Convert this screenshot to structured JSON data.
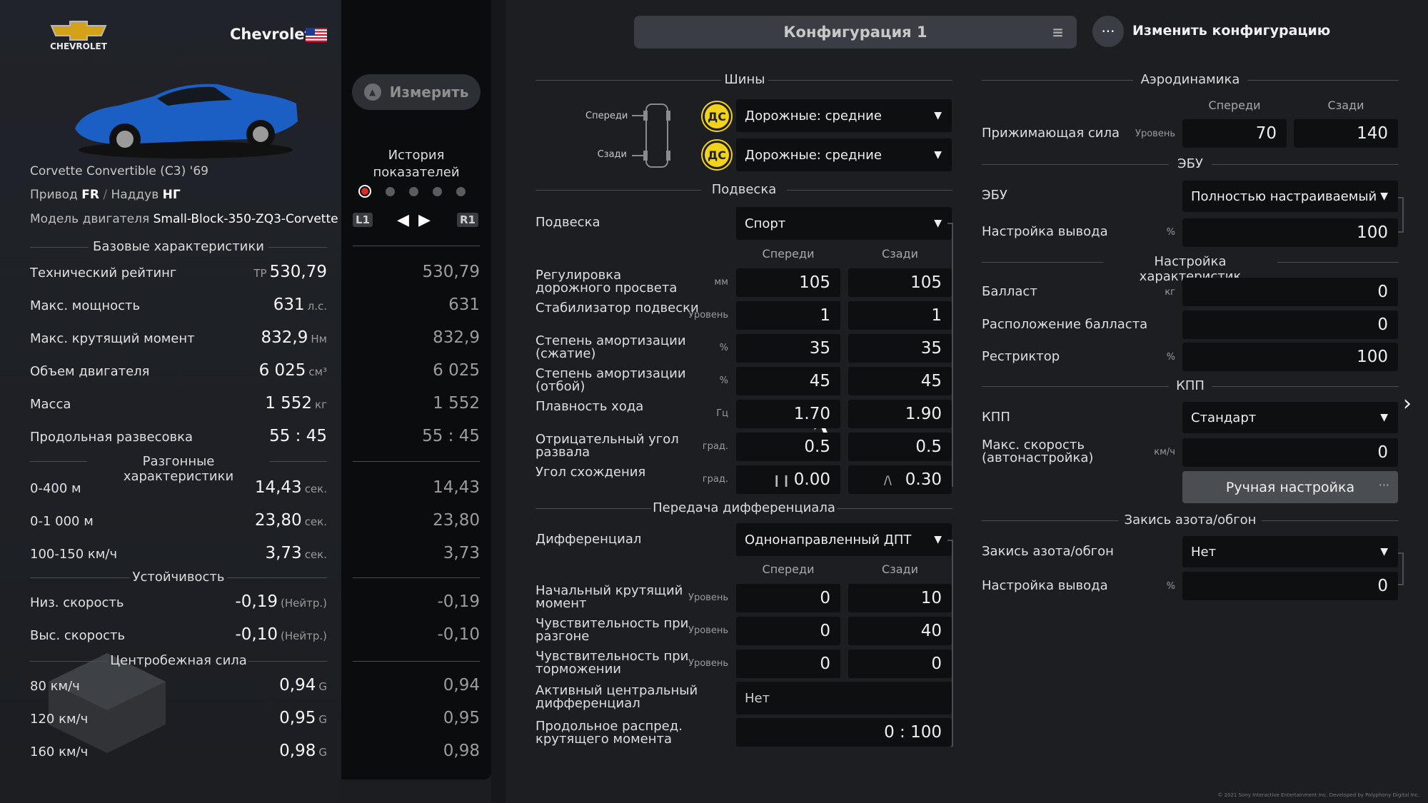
{
  "car": {
    "brand": "Chevrolet",
    "logo_text": "CHEVROLET",
    "model": "Corvette Convertible (C3) '69",
    "drive_label": "Привод",
    "drive_value": "FR",
    "asp_label": "Наддув",
    "asp_value": "НГ",
    "engine_label": "Модель двигателя",
    "engine_value": "Small-Block-350-ZQ3-Corvette"
  },
  "sections": {
    "base": "Базовые характеристики",
    "accel": "Разгонные характеристики",
    "stability": "Устойчивость",
    "gforce": "Центробежная сила"
  },
  "stats": [
    {
      "label": "Технический рейтинг",
      "prefix": "ТР",
      "value": "530,79",
      "unit": "",
      "hist": "530,79"
    },
    {
      "label": "Макс. мощность",
      "prefix": "",
      "value": "631",
      "unit": "л.с.",
      "hist": "631"
    },
    {
      "label": "Макс. крутящий момент",
      "prefix": "",
      "value": "832,9",
      "unit": "Нм",
      "hist": "832,9"
    },
    {
      "label": "Объем двигателя",
      "prefix": "",
      "value": "6 025",
      "unit": "см³",
      "hist": "6 025"
    },
    {
      "label": "Масса",
      "prefix": "",
      "value": "1 552",
      "unit": "кг",
      "hist": "1 552"
    },
    {
      "label": "Продольная развесовка",
      "prefix": "",
      "value": "55 : 45",
      "unit": "",
      "hist": "55 : 45"
    }
  ],
  "accel": [
    {
      "label": "0-400 м",
      "value": "14,43",
      "unit": "сек.",
      "hist": "14,43"
    },
    {
      "label": "0-1 000 м",
      "value": "23,80",
      "unit": "сек.",
      "hist": "23,80"
    },
    {
      "label": "100-150 км/ч",
      "value": "3,73",
      "unit": "сек.",
      "hist": "3,73"
    }
  ],
  "stability": [
    {
      "label": "Низ. скорость",
      "value": "-0,19",
      "unit": "(Нейтр.)",
      "hist": "-0,19"
    },
    {
      "label": "Выс. скорость",
      "value": "-0,10",
      "unit": "(Нейтр.)",
      "hist": "-0,10"
    }
  ],
  "gforce": [
    {
      "label": "80 км/ч",
      "value": "0,94",
      "unit": "G",
      "hist": "0,94"
    },
    {
      "label": "120 км/ч",
      "value": "0,95",
      "unit": "G",
      "hist": "0,95"
    },
    {
      "label": "160 км/ч",
      "value": "0,98",
      "unit": "G",
      "hist": "0,98"
    }
  ],
  "history": {
    "measure_label": "Измерить",
    "title": "История показателей",
    "l1": "L1",
    "r1": "R1"
  },
  "config": {
    "name": "Конфигурация 1",
    "change_label": "Изменить конфигурацию"
  },
  "tires": {
    "title": "Шины",
    "front_label": "Спереди",
    "rear_label": "Сзади",
    "front_badge": "ДС",
    "rear_badge": "ДС",
    "front_value": "Дорожные: средние",
    "rear_value": "Дорожные: средние"
  },
  "suspension": {
    "title": "Подвеска",
    "label": "Подвеска",
    "value": "Спорт",
    "col_front": "Спереди",
    "col_rear": "Сзади",
    "rows": [
      {
        "label": "Регулировка дорожного просвета",
        "unit": "мм",
        "front": "105",
        "rear": "105"
      },
      {
        "label": "Стабилизатор подвески",
        "unit": "Уровень",
        "front": "1",
        "rear": "1"
      },
      {
        "label": "Степень амортизации (сжатие)",
        "unit": "%",
        "front": "35",
        "rear": "35"
      },
      {
        "label": "Степень амортизации (отбой)",
        "unit": "%",
        "front": "45",
        "rear": "45"
      },
      {
        "label": "Плавность хода",
        "unit": "Гц",
        "front": "1.70",
        "rear": "1.90"
      },
      {
        "label": "Отрицательный угол развала",
        "unit": "град.",
        "front": "0.5",
        "rear": "0.5"
      },
      {
        "label": "Угол схождения",
        "unit": "град.",
        "front": "0.00",
        "rear": "0.30"
      }
    ]
  },
  "diff": {
    "title": "Передача дифференциала",
    "label": "Дифференциал",
    "value": "Однонаправленный ДПТ",
    "col_front": "Спереди",
    "col_rear": "Сзади",
    "rows": [
      {
        "label": "Начальный крутящий момент",
        "unit": "Уровень",
        "front": "0",
        "rear": "10"
      },
      {
        "label": "Чувствительность при разгоне",
        "unit": "Уровень",
        "front": "0",
        "rear": "40"
      },
      {
        "label": "Чувствительность при торможении",
        "unit": "Уровень",
        "front": "0",
        "rear": "0"
      }
    ],
    "center_label": "Активный центральный дифференциал",
    "center_value": "Нет",
    "split_label": "Продольное распред. крутящего момента",
    "split_value": "0 : 100"
  },
  "aero": {
    "title": "Аэродинамика",
    "col_front": "Спереди",
    "col_rear": "Сзади",
    "label": "Прижимающая сила",
    "unit": "Уровень",
    "front": "70",
    "rear": "140"
  },
  "ecu": {
    "title": "ЭБУ",
    "label": "ЭБУ",
    "value": "Полностью настраиваемый",
    "output_label": "Настройка вывода",
    "output_unit": "%",
    "output_value": "100"
  },
  "perf": {
    "title": "Настройка характеристик",
    "ballast_label": "Балласт",
    "ballast_unit": "кг",
    "ballast_value": "0",
    "pos_label": "Расположение балласта",
    "pos_value": "0",
    "restr_label": "Рестриктор",
    "restr_unit": "%",
    "restr_value": "100"
  },
  "gearbox": {
    "title": "КПП",
    "label": "КПП",
    "value": "Стандарт",
    "max_label": "Макс. скорость (автонастройка)",
    "max_unit": "км/ч",
    "max_value": "0",
    "manual_label": "Ручная настройка"
  },
  "nitro": {
    "title": "Закись азота/обгон",
    "label": "Закись азота/обгон",
    "value": "Нет",
    "output_label": "Настройка вывода",
    "output_unit": "%",
    "output_value": "0"
  },
  "footer": {
    "copyright": "© 2021 Sony Interactive Entertainment Inc. Developed by Polyphony Digital Inc."
  },
  "colors": {
    "accent_tire": "#f2d21b",
    "car_blue": "#1c5fc4"
  }
}
